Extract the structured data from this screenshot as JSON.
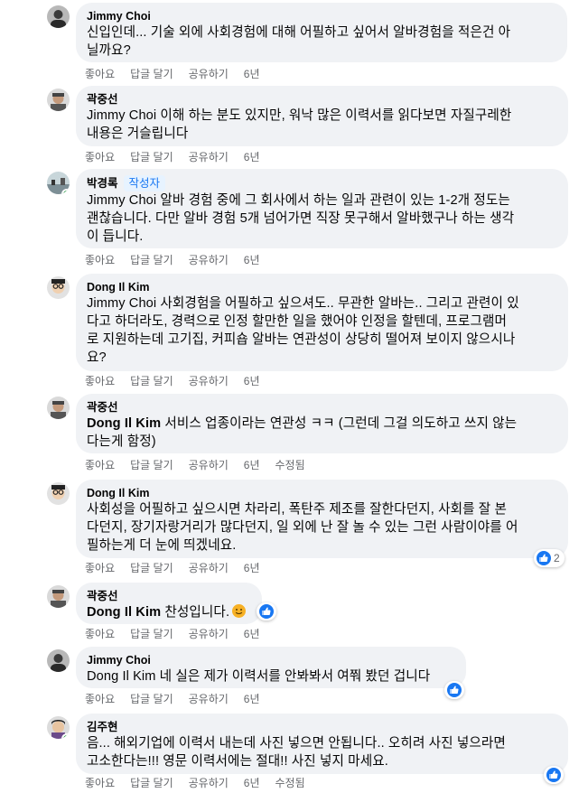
{
  "actions": {
    "like": "좋아요",
    "reply": "답글 달기",
    "share": "공유하기"
  },
  "comments": [
    {
      "author": "Jimmy Choi",
      "badge": "",
      "lines": [
        "신입인데... 기술 외에 사회경험에 대해 어필하고 싶어서 알바경험을 적은건 아",
        "닐까요?"
      ],
      "time": "6년",
      "edited": ""
    },
    {
      "author": "곽중선",
      "badge": "",
      "lines": [
        "Jimmy Choi 이해 하는 분도 있지만, 워낙 많은 이력서를 읽다보면 자질구레한",
        "내용은 거슬립니다"
      ],
      "time": "6년",
      "edited": ""
    },
    {
      "author": "박경록",
      "badge": "작성자",
      "lines": [
        "Jimmy Choi 알바 경험 중에 그 회사에서 하는 일과 관련이 있는 1-2개 정도는",
        "괜찮습니다. 다만 알바 경험 5개 넘어가면 직장 못구해서 알바했구나 하는 생각",
        "이 듭니다."
      ],
      "time": "6년",
      "edited": ""
    },
    {
      "author": "Dong Il Kim",
      "badge": "",
      "lines": [
        "Jimmy Choi 사회경험을 어필하고 싶으셔도.. 무관한 알바는.. 그리고 관련이 있",
        "다고 하더라도, 경력으로 인정 할만한 일을 했어야 인정을 할텐데, 프로그램머",
        "로 지원하는데 고기집, 커피숍 알바는 연관성이 상당히 떨어져 보이지 않으시나",
        "요?"
      ],
      "time": "6년",
      "edited": ""
    },
    {
      "author": "곽중선",
      "badge": "",
      "mention": "Dong Il Kim",
      "lines": [
        " 서비스 업종이라는 연관성 ㅋㅋ (그런데 그걸 의도하고 쓰지 않는",
        "다는게 함정)"
      ],
      "time": "6년",
      "edited": "수정됨"
    },
    {
      "author": "Dong Il Kim",
      "badge": "",
      "lines": [
        "사회성을 어필하고 싶으시면 차라리, 폭탄주 제조를 잘한다던지, 사회를 잘 본",
        "다던지, 장기자랑거리가 많다던지, 일 외에 난 잘 놀 수 있는 그런 사람이야를 어",
        "필하는게 더 눈에 띄겠네요."
      ],
      "time": "6년",
      "edited": "",
      "reaction_count": "2"
    },
    {
      "author": "곽중선",
      "badge": "",
      "mention": "Dong Il Kim",
      "lines": [
        " 찬성입니다."
      ],
      "time": "6년",
      "edited": ""
    },
    {
      "author": "Jimmy Choi",
      "badge": "",
      "lines": [
        "Dong Il Kim 네 실은 제가 이력서를 안봐봐서 여쭤 봤던 겁니다"
      ],
      "time": "6년",
      "edited": ""
    },
    {
      "author": "김주현",
      "badge": "",
      "lines": [
        "음... 해외기업에 이력서 내는데 사진 넣으면 안됩니다.. 오히려 사진 넣으라면",
        "고소한다는!!! 영문 이력서에는 절대!! 사진 넣지 마세요."
      ],
      "time": "6년",
      "edited": "수정됨"
    }
  ],
  "colors": {
    "bubble": "#f0f2f5",
    "meta": "#65676b",
    "accent": "#1877f2",
    "online": "#31a24c"
  }
}
